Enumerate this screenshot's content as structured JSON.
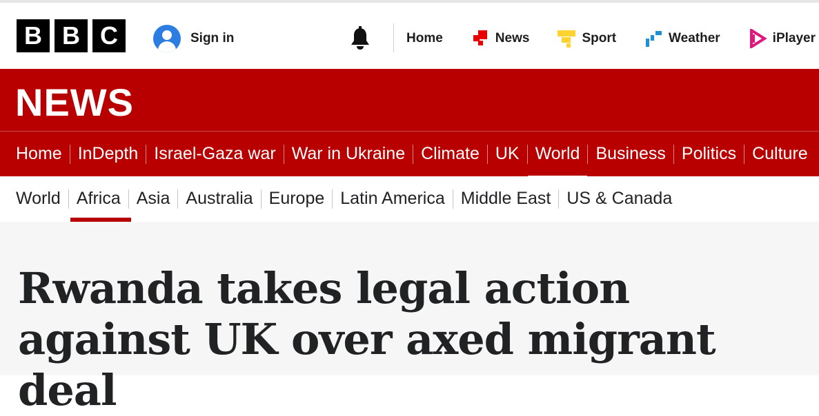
{
  "brand": {
    "letters": [
      "B",
      "B",
      "C"
    ]
  },
  "account": {
    "sign_in_label": "Sign in"
  },
  "top_nav": [
    {
      "label": "Home",
      "icon": "home"
    },
    {
      "label": "News",
      "icon": "news-icon",
      "color": "#e80000"
    },
    {
      "label": "Sport",
      "icon": "sport-icon",
      "color": "#ffd230"
    },
    {
      "label": "Weather",
      "icon": "weather-icon",
      "color": "#1e8ed6"
    },
    {
      "label": "iPlayer",
      "icon": "iplayer-icon",
      "color": "#e0177d"
    }
  ],
  "section": {
    "title": "NEWS",
    "color": "#b80000"
  },
  "main_nav": [
    "Home",
    "InDepth",
    "Israel-Gaza war",
    "War in Ukraine",
    "Climate",
    "UK",
    "World",
    "Business",
    "Politics",
    "Culture"
  ],
  "main_nav_active": "World",
  "sub_nav": [
    "World",
    "Africa",
    "Asia",
    "Australia",
    "Europe",
    "Latin America",
    "Middle East",
    "US & Canada"
  ],
  "sub_nav_active": "Africa",
  "article": {
    "headline": "Rwanda takes legal action against UK over axed migrant deal"
  }
}
